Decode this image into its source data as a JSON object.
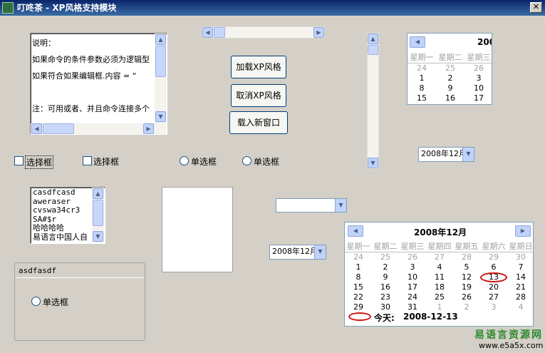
{
  "window": {
    "title": "叮咚茶 - XP风格支持模块",
    "close": "✕"
  },
  "textbox": {
    "lines": [
      "说明：",
      "如果命令的条件参数必须为逻辑型",
      "如果符合如果编辑框.内容 = “",
      "",
      "注：可用或者、并且命令连接多个"
    ]
  },
  "buttons": {
    "load_xp": "加载XP风格",
    "cancel_xp": "取消XP风格",
    "load_window": "载入新窗口"
  },
  "checkboxes": [
    "选择框",
    "选择框"
  ],
  "radios": [
    "单选框",
    "单选框"
  ],
  "listbox": {
    "items": [
      "casdfcasd",
      "aweraser",
      "cvswa34cr3",
      "SA#$r",
      "哈哈哈哈",
      "易语言中国人自"
    ]
  },
  "groupbox": {
    "title": "asdfasdf",
    "radio": "单选框"
  },
  "datepickers": {
    "top": "2008年12月",
    "mid": "2008年12月"
  },
  "cal_small": {
    "title": "200",
    "weekdays": [
      "星期一",
      "星期二",
      "星期三"
    ],
    "rows": [
      [
        "24",
        "25",
        "26"
      ],
      [
        "1",
        "2",
        "3"
      ],
      [
        "8",
        "9",
        "10"
      ],
      [
        "15",
        "16",
        "17"
      ]
    ]
  },
  "cal_big": {
    "title": "2008年12月",
    "weekdays": [
      "星期一",
      "星期二",
      "星期三",
      "星期四",
      "星期五",
      "星期六",
      "星期日"
    ],
    "rows": [
      [
        "24",
        "25",
        "26",
        "27",
        "28",
        "29",
        "30"
      ],
      [
        "1",
        "2",
        "3",
        "4",
        "5",
        "6",
        "7"
      ],
      [
        "8",
        "9",
        "10",
        "11",
        "12",
        "13",
        "14"
      ],
      [
        "15",
        "16",
        "17",
        "18",
        "19",
        "20",
        "21"
      ],
      [
        "22",
        "23",
        "24",
        "25",
        "26",
        "27",
        "28"
      ],
      [
        "29",
        "30",
        "31",
        "1",
        "2",
        "3",
        "4"
      ]
    ],
    "today_label": "今天:",
    "today_value": "2008-12-13"
  },
  "watermark": {
    "line1": "易语言资源网",
    "line2": "www.e5a5x.com"
  }
}
